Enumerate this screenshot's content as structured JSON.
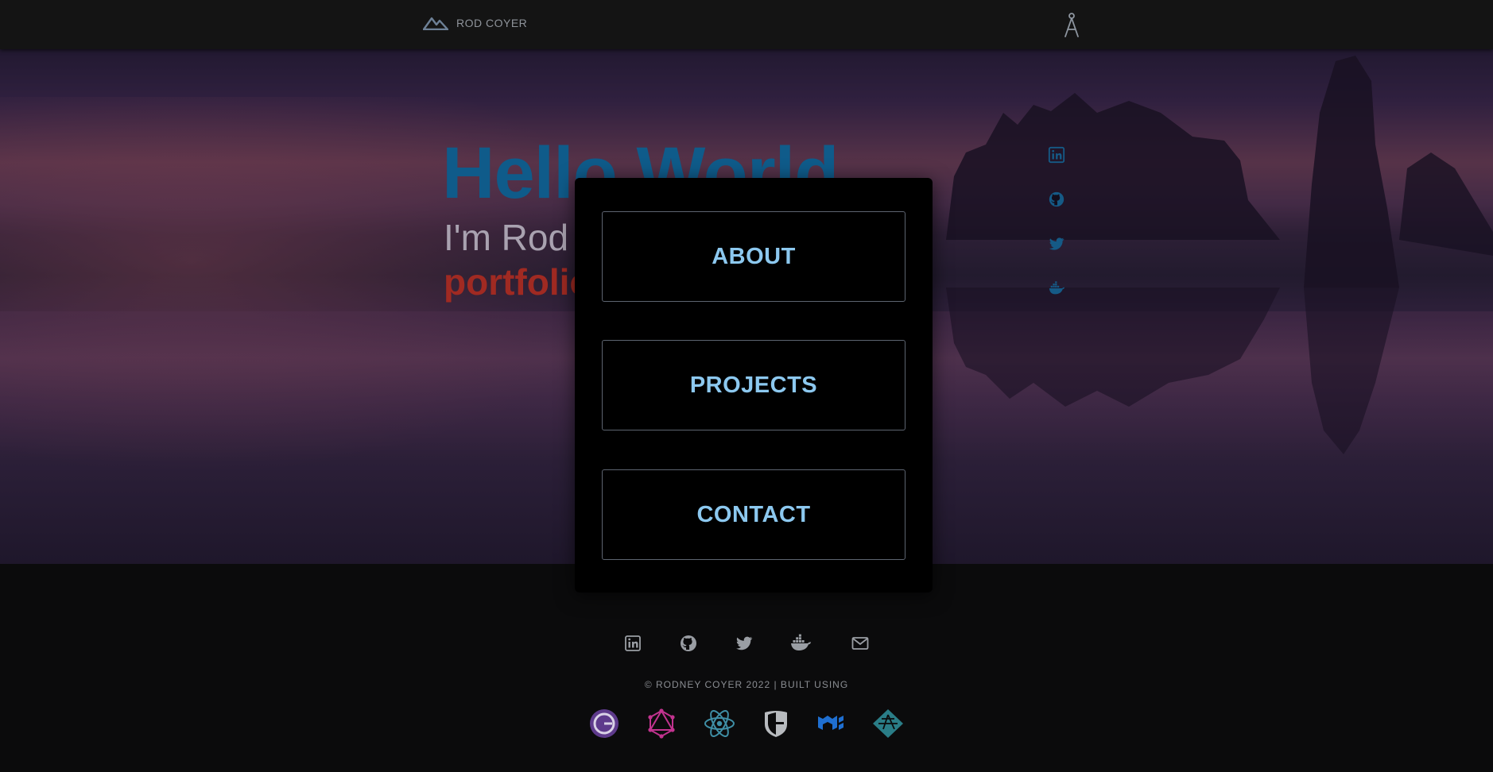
{
  "header": {
    "brand_label": "ROD COYER"
  },
  "hero": {
    "heading": "Hello World",
    "intro": "I'm Rod",
    "accent": "portfolio"
  },
  "side_social": [
    {
      "icon": "linkedin-icon"
    },
    {
      "icon": "github-icon"
    },
    {
      "icon": "twitter-icon"
    },
    {
      "icon": "docker-icon"
    }
  ],
  "menu": {
    "about_label": "ABOUT",
    "projects_label": "PROJECTS",
    "contact_label": "CONTACT"
  },
  "footer": {
    "social": [
      {
        "icon": "linkedin-icon"
      },
      {
        "icon": "github-icon"
      },
      {
        "icon": "twitter-icon"
      },
      {
        "icon": "docker-icon"
      },
      {
        "icon": "mail-icon"
      }
    ],
    "copyright": "© RODNEY COYER 2022 | BUILT USING",
    "tech": [
      {
        "icon": "gatsby-icon"
      },
      {
        "icon": "graphql-icon"
      },
      {
        "icon": "react-icon"
      },
      {
        "icon": "apollo-shield-icon"
      },
      {
        "icon": "mui-icon"
      },
      {
        "icon": "netlify-icon"
      }
    ]
  },
  "colors": {
    "accent_blue": "#0f5b8a",
    "menu_text": "#8cc8ef",
    "accent_red": "#a02a22",
    "header_bg": "#141414",
    "page_bg": "#0b0b0c"
  }
}
